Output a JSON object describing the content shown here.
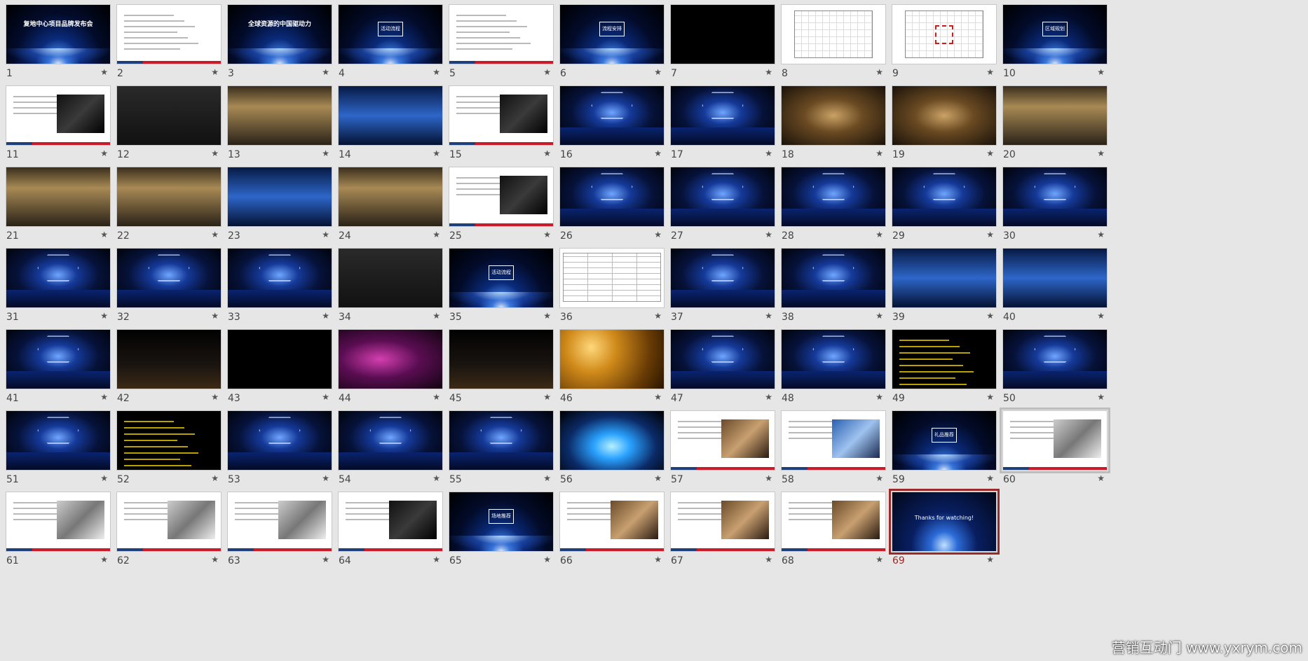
{
  "slides": [
    {
      "n": "1",
      "style": "stage",
      "caption": "复地中心项目品牌发布会"
    },
    {
      "n": "2",
      "style": "white-lines"
    },
    {
      "n": "3",
      "style": "stage-title",
      "caption": "全球资源的中国驱动力"
    },
    {
      "n": "4",
      "style": "stage-box",
      "caption": "活动流程"
    },
    {
      "n": "5",
      "style": "white-lines"
    },
    {
      "n": "6",
      "style": "stage-box",
      "caption": "流程安排"
    },
    {
      "n": "7",
      "style": "black"
    },
    {
      "n": "8",
      "style": "plan"
    },
    {
      "n": "9",
      "style": "plan-red"
    },
    {
      "n": "10",
      "style": "stage-box",
      "caption": "区域规划"
    },
    {
      "n": "11",
      "style": "photo-dark"
    },
    {
      "n": "12",
      "style": "dark"
    },
    {
      "n": "13",
      "style": "warm"
    },
    {
      "n": "14",
      "style": "screens"
    },
    {
      "n": "15",
      "style": "photo-dark"
    },
    {
      "n": "16",
      "style": "hall"
    },
    {
      "n": "17",
      "style": "hall"
    },
    {
      "n": "18",
      "style": "gold2"
    },
    {
      "n": "19",
      "style": "gold2"
    },
    {
      "n": "20",
      "style": "warm"
    },
    {
      "n": "21",
      "style": "warm"
    },
    {
      "n": "22",
      "style": "warm"
    },
    {
      "n": "23",
      "style": "screens"
    },
    {
      "n": "24",
      "style": "warm"
    },
    {
      "n": "25",
      "style": "photo-dark"
    },
    {
      "n": "26",
      "style": "hall"
    },
    {
      "n": "27",
      "style": "hall"
    },
    {
      "n": "28",
      "style": "hall"
    },
    {
      "n": "29",
      "style": "hall"
    },
    {
      "n": "30",
      "style": "hall"
    },
    {
      "n": "31",
      "style": "hall"
    },
    {
      "n": "32",
      "style": "hall"
    },
    {
      "n": "33",
      "style": "hall"
    },
    {
      "n": "34",
      "style": "dark"
    },
    {
      "n": "35",
      "style": "stage-box",
      "caption": "活动流程"
    },
    {
      "n": "36",
      "style": "table"
    },
    {
      "n": "37",
      "style": "hall"
    },
    {
      "n": "38",
      "style": "hall"
    },
    {
      "n": "39",
      "style": "screens"
    },
    {
      "n": "40",
      "style": "screens"
    },
    {
      "n": "41",
      "style": "hall"
    },
    {
      "n": "42",
      "style": "night"
    },
    {
      "n": "43",
      "style": "black"
    },
    {
      "n": "44",
      "style": "magenta"
    },
    {
      "n": "45",
      "style": "night"
    },
    {
      "n": "46",
      "style": "gold"
    },
    {
      "n": "47",
      "style": "hall"
    },
    {
      "n": "48",
      "style": "hall"
    },
    {
      "n": "49",
      "style": "yellow-lines"
    },
    {
      "n": "50",
      "style": "hall"
    },
    {
      "n": "51",
      "style": "hall"
    },
    {
      "n": "52",
      "style": "yellow-lines"
    },
    {
      "n": "53",
      "style": "hall"
    },
    {
      "n": "54",
      "style": "hall"
    },
    {
      "n": "55",
      "style": "hall"
    },
    {
      "n": "56",
      "style": "laser"
    },
    {
      "n": "57",
      "style": "photo-warm"
    },
    {
      "n": "58",
      "style": "photo-blue"
    },
    {
      "n": "59",
      "style": "stage-box",
      "caption": "礼品推荐"
    },
    {
      "n": "60",
      "style": "photo-gadget"
    },
    {
      "n": "61",
      "style": "photo-gadget"
    },
    {
      "n": "62",
      "style": "photo-gadget"
    },
    {
      "n": "63",
      "style": "photo-gadget"
    },
    {
      "n": "64",
      "style": "photo-dark"
    },
    {
      "n": "65",
      "style": "stage-box",
      "caption": "场地推荐"
    },
    {
      "n": "66",
      "style": "photo-warm"
    },
    {
      "n": "67",
      "style": "photo-warm"
    },
    {
      "n": "68",
      "style": "photo-warm"
    },
    {
      "n": "69",
      "style": "thanks",
      "caption": "Thanks for watching!"
    }
  ],
  "selected_slide": "69",
  "hovered_slide": "60",
  "star_glyph": "★",
  "watermark": "营销互动门 www.yxrym.com",
  "colors": {
    "background": "#e6e6e6",
    "selection": "#9b2a2a",
    "accent_blue": "#1d3f7a",
    "accent_red": "#c91c2a"
  }
}
